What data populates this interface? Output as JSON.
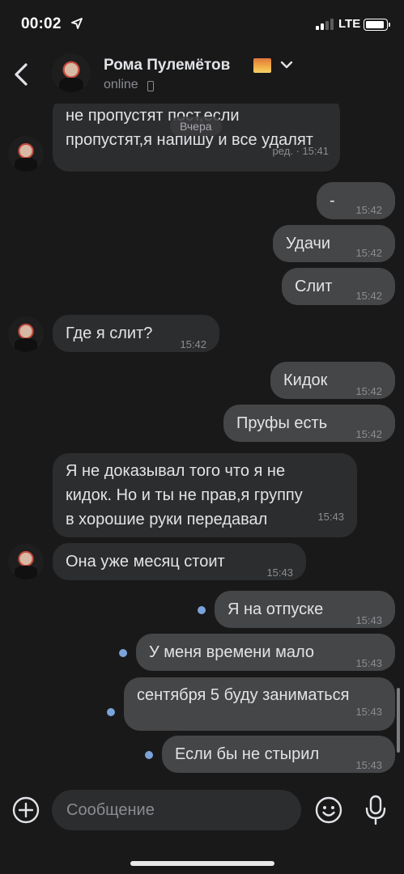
{
  "status_bar": {
    "time": "00:02",
    "network": "LTE"
  },
  "header": {
    "contact_name": "Рома Пулемётов",
    "status": "online",
    "icons": [
      "back-icon",
      "avatar",
      "sunset-emoji-icon",
      "chevron-down-icon",
      "phone-icon"
    ]
  },
  "chat": {
    "date_label": "Вчера",
    "messages": [
      {
        "dir": "in",
        "text": "не пропустят пост,если\nпропустят,я напишу и все удалят",
        "time": "ред. · 15:41"
      },
      {
        "dir": "out",
        "text": "-",
        "time": "15:42"
      },
      {
        "dir": "out",
        "text": "Удачи",
        "time": "15:42"
      },
      {
        "dir": "out",
        "text": "Слит",
        "time": "15:42"
      },
      {
        "dir": "in",
        "text": "Где я слит?",
        "time": "15:42"
      },
      {
        "dir": "out",
        "text": "Кидок",
        "time": "15:42"
      },
      {
        "dir": "out",
        "text": "Пруфы есть",
        "time": "15:42"
      },
      {
        "dir": "in",
        "text": "Я не доказывал того что я не\nкидок. Но и ты не прав,я группу\nв хорошие руки передавал",
        "time": "15:43"
      },
      {
        "dir": "in",
        "text": "Она уже месяц стоит",
        "time": "15:43"
      },
      {
        "dir": "out",
        "text": "Я на отпуске",
        "time": "15:43",
        "unread": true
      },
      {
        "dir": "out",
        "text": "У меня времени мало",
        "time": "15:43",
        "unread": true
      },
      {
        "dir": "out",
        "text": "сентября 5 буду заниматься",
        "time": "15:43",
        "unread": true
      },
      {
        "dir": "out",
        "text": "Если бы не стырил",
        "time": "15:43",
        "unread": true
      }
    ]
  },
  "input": {
    "placeholder": "Сообщение",
    "icons": [
      "add-icon",
      "emoji-icon",
      "microphone-icon"
    ]
  },
  "colors": {
    "background": "#19191a",
    "incoming_bubble": "#2c2d2e",
    "outgoing_bubble": "#454647",
    "unread_dot": "#7aa3d9",
    "text": "#e1e3e6",
    "secondary_text": "#8a8c91"
  }
}
